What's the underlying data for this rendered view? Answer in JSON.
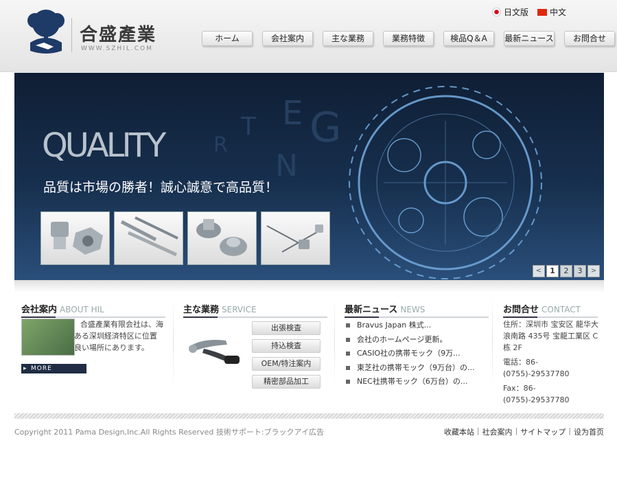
{
  "header": {
    "logo_name": "合盛產業",
    "logo_url": "WWW.SZHIL.COM",
    "languages": [
      {
        "label": "日文版",
        "icon": "japan-flag-icon"
      },
      {
        "label": "中文",
        "icon": "china-flag-icon"
      }
    ],
    "nav": [
      "ホーム",
      "会社案内",
      "主な業務",
      "業務特徴",
      "検品Q＆A",
      "最新ニュース",
      "お問合せ"
    ]
  },
  "banner": {
    "headline": "QUALITY",
    "slogan": "品質は市場の勝者！誠心誠意で高品質！",
    "background_letters": [
      "T",
      "E",
      "G",
      "R",
      "N"
    ],
    "pager": {
      "prev": "<",
      "pages": [
        "1",
        "2",
        "3"
      ],
      "next": ">",
      "active": "1"
    }
  },
  "about": {
    "title": "会社案内",
    "title_en": "ABOUT HIL",
    "text": "合盛產業有限会社は、海外への玄関口である深圳経済特区に位置し、交通の便が良い場所にあります。",
    "more": "MORE CONTENT"
  },
  "service": {
    "title": "主な業務",
    "title_en": "SERVICE",
    "buttons": [
      "出張検査",
      "持込検査",
      "OEM/特注案内",
      "精密部品加工"
    ]
  },
  "news": {
    "title": "最新ニュース",
    "title_en": "NEWS",
    "items": [
      "Bravus Japan 株式...",
      "会社のホームページ更新。",
      "CASIO社の携帯モック（9万...",
      "東芝社の携帯モック（9万台）の...",
      "NEC社携帯モック（6万台）の..."
    ]
  },
  "contact": {
    "title": "お問合せ",
    "title_en": "CONTACT",
    "address": "住所：深圳市 宝安区 龍华大浪南路 435号 宝龍工業区 C栋 2F",
    "phone": "電話：86-(0755)-29537780",
    "fax": "Fax：86-(0755)-29537780"
  },
  "footer": {
    "copyright": "Copyright 2011 Pama Design,Inc.All Rights Reserved 技術サポート:ブラックアイ広告",
    "links": [
      "收藏本站",
      "社会案内",
      "サイトマップ",
      "设为首页"
    ]
  },
  "colors": {
    "banner_dark": "#0f1e34",
    "banner_light": "#2a4f7a",
    "more_button": "#1f2c44",
    "logo_blue": "#1e3b68"
  }
}
